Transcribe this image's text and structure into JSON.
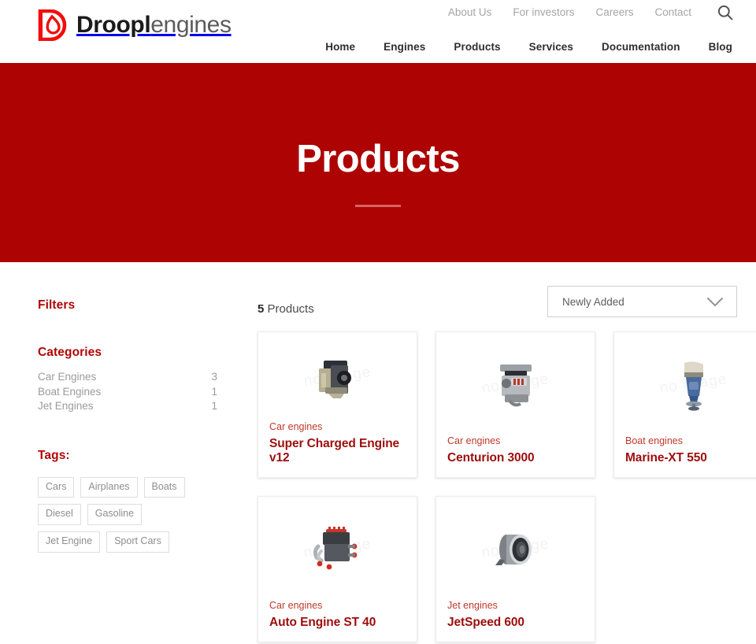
{
  "header": {
    "brand": {
      "bold": "Droopl",
      "light": "engines",
      "logo_icon": "droplet-logo-icon",
      "logo_color": "#f20d0d"
    },
    "utility_nav": [
      {
        "label": "About Us"
      },
      {
        "label": "For investors"
      },
      {
        "label": "Careers"
      },
      {
        "label": "Contact"
      }
    ],
    "search_icon": "search-icon",
    "main_nav": [
      {
        "label": "Home"
      },
      {
        "label": "Engines"
      },
      {
        "label": "Products"
      },
      {
        "label": "Services"
      },
      {
        "label": "Documentation"
      },
      {
        "label": "Blog"
      }
    ]
  },
  "hero": {
    "title": "Products",
    "background_color": "#ad0303",
    "rule_color": "#d96363"
  },
  "sidebar": {
    "filters_heading": "Filters",
    "categories_heading": "Categories",
    "categories": [
      {
        "label": "Car Engines",
        "count": "3"
      },
      {
        "label": "Boat Engines",
        "count": "1"
      },
      {
        "label": "Jet Engines",
        "count": "1"
      }
    ],
    "tags_heading": "Tags:",
    "tags": [
      {
        "label": "Cars"
      },
      {
        "label": "Airplanes"
      },
      {
        "label": "Boats"
      },
      {
        "label": "Diesel"
      },
      {
        "label": "Gasoline"
      },
      {
        "label": "Jet Engine"
      },
      {
        "label": "Sport Cars"
      }
    ],
    "accent_color": "#b00505"
  },
  "toolbar": {
    "count": "5",
    "count_suffix": " Products",
    "sort_selected": "Newly Added",
    "sort_chevron_icon": "chevron-down-icon"
  },
  "products": [
    {
      "category": "Car engines",
      "title": "Super Charged Engine v12",
      "image_icon": "car-engine-photo",
      "watermark": "no image"
    },
    {
      "category": "Car engines",
      "title": "Centurion 3000",
      "image_icon": "v8-engine-photo",
      "watermark": "no image"
    },
    {
      "category": "Boat engines",
      "title": "Marine-XT 550",
      "image_icon": "outboard-motor-photo",
      "watermark": "no image"
    },
    {
      "category": "Car engines",
      "title": "Auto Engine ST 40",
      "image_icon": "auto-engine-photo",
      "watermark": "no image"
    },
    {
      "category": "Jet engines",
      "title": "JetSpeed 600",
      "image_icon": "jet-turbine-photo",
      "watermark": "no image"
    }
  ]
}
